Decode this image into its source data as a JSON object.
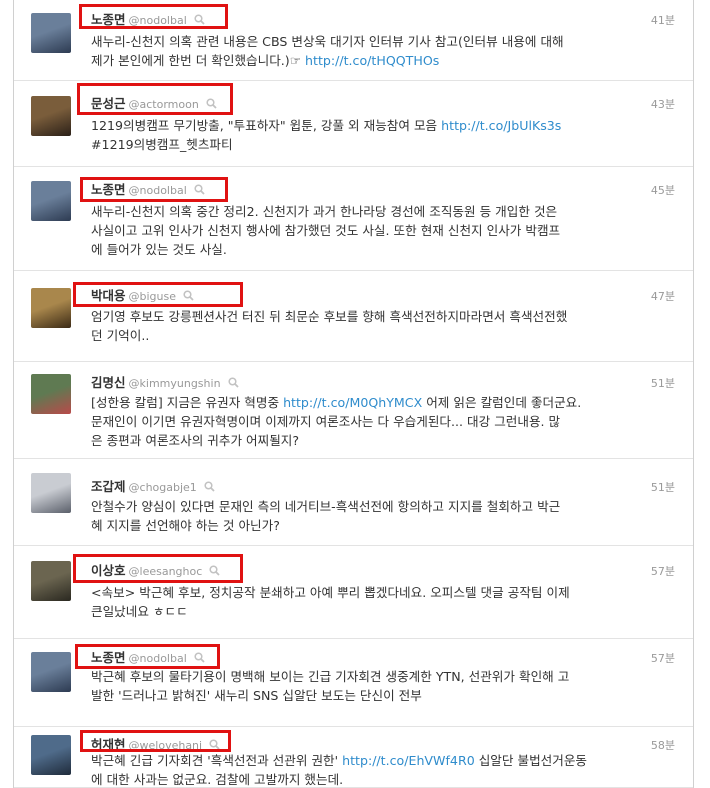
{
  "tweets": [
    {
      "name": "노종면",
      "handle": "@nodolbal",
      "time": "41분",
      "lines": [
        [
          {
            "t": "새누리-신천지 의혹 관련 내용은 CBS 변상욱 대기자 인터뷰 기사 참고(인터뷰 내용에 대해"
          }
        ],
        [
          {
            "t": "제가 본인에게 한번 더 확인했습니다.)☞ "
          },
          {
            "t": "http://t.co/tHQQTHOs",
            "link": true
          }
        ]
      ]
    },
    {
      "name": "문성근",
      "handle": "@actormoon",
      "time": "43분",
      "lines": [
        [
          {
            "t": "1219의병캠프 무기방출, \"투표하자\" 윕툰, 강풀 외 재능참여 모음 "
          },
          {
            "t": "http://t.co/JbUlKs3s",
            "link": true
          }
        ],
        [
          {
            "t": "#1219의병캠프_헷츠파티"
          }
        ]
      ]
    },
    {
      "name": "노종면",
      "handle": "@nodolbal",
      "time": "45분",
      "lines": [
        [
          {
            "t": "새누리-신천지 의혹 중간 정리2. 신천지가 과거 한나라당 경선에 조직동원 등 개입한 것은"
          }
        ],
        [
          {
            "t": "사실이고 고위 인사가 신천지 행사에 참가했던 것도 사실. 또한 현재 신천지 인사가 박캠프"
          }
        ],
        [
          {
            "t": "에 들어가 있는 것도 사실."
          }
        ]
      ]
    },
    {
      "name": "박대용",
      "handle": "@biguse",
      "time": "47분",
      "lines": [
        [
          {
            "t": "엄기영 후보도 강릉펜션사건 터진 뒤 최문순 후보를 향해 흑색선전하지마라면서 흑색선전했"
          }
        ],
        [
          {
            "t": "던 기억이.."
          }
        ]
      ]
    },
    {
      "name": "김명신",
      "handle": "@kimmyungshin",
      "time": "51분",
      "lines": [
        [
          {
            "t": "[성한용 칼럼] 지금은 유권자 혁명중 "
          },
          {
            "t": "http://t.co/M0QhYMCX",
            "link": true
          },
          {
            "t": " 어제 읽은 칼럼인데 좋더군요."
          }
        ],
        [
          {
            "t": "문재인이 이기면 유권자혁명이며 이제까지 여론조사는 다 우습게된다... 대강 그런내용. 많"
          }
        ],
        [
          {
            "t": "은 종편과 여론조사의 귀추가 어찌될지?"
          }
        ]
      ]
    },
    {
      "name": "조갑제",
      "handle": "@chogabje1",
      "time": "51분",
      "lines": [
        [
          {
            "t": "안철수가 양심이 있다면 문재인 측의 네거티브-흑색선전에 항의하고 지지를 철회하고 박근"
          }
        ],
        [
          {
            "t": "혜 지지를 선언해야 하는 것 아닌가?"
          }
        ]
      ]
    },
    {
      "name": "이상호",
      "handle": "@leesanghoc",
      "time": "57분",
      "lines": [
        [
          {
            "t": "<속보> 박근혜 후보, 정치공작 분쇄하고 아예 뿌리 뽑겠다네요. 오피스텔 댓글 공작팀 이제"
          }
        ],
        [
          {
            "t": "큰일났네요 ㅎㄷㄷ"
          }
        ]
      ]
    },
    {
      "name": "노종면",
      "handle": "@nodolbal",
      "time": "57분",
      "lines": [
        [
          {
            "t": "박근혜 후보의 물타기용이 명백해 보이는 긴급 기자회견 생중계한 YTN, 선관위가 확인해 고"
          }
        ],
        [
          {
            "t": "발한 '드러나고 밝혀진' 새누리 SNS 십알단 보도는 단신이 전부"
          }
        ]
      ]
    },
    {
      "name": "허재현",
      "handle": "@welovehani",
      "time": "58분",
      "lines": [
        [
          {
            "t": "박근혜 긴급 기자회견 '흑색선전과 선관위 권한' "
          },
          {
            "t": "http://t.co/EhVWf4R0",
            "link": true
          },
          {
            "t": " 십알단 불법선거운동"
          }
        ],
        [
          {
            "t": "에 대한 사과는 없군요. 검찰에 고발까지 했는데."
          }
        ]
      ]
    }
  ]
}
